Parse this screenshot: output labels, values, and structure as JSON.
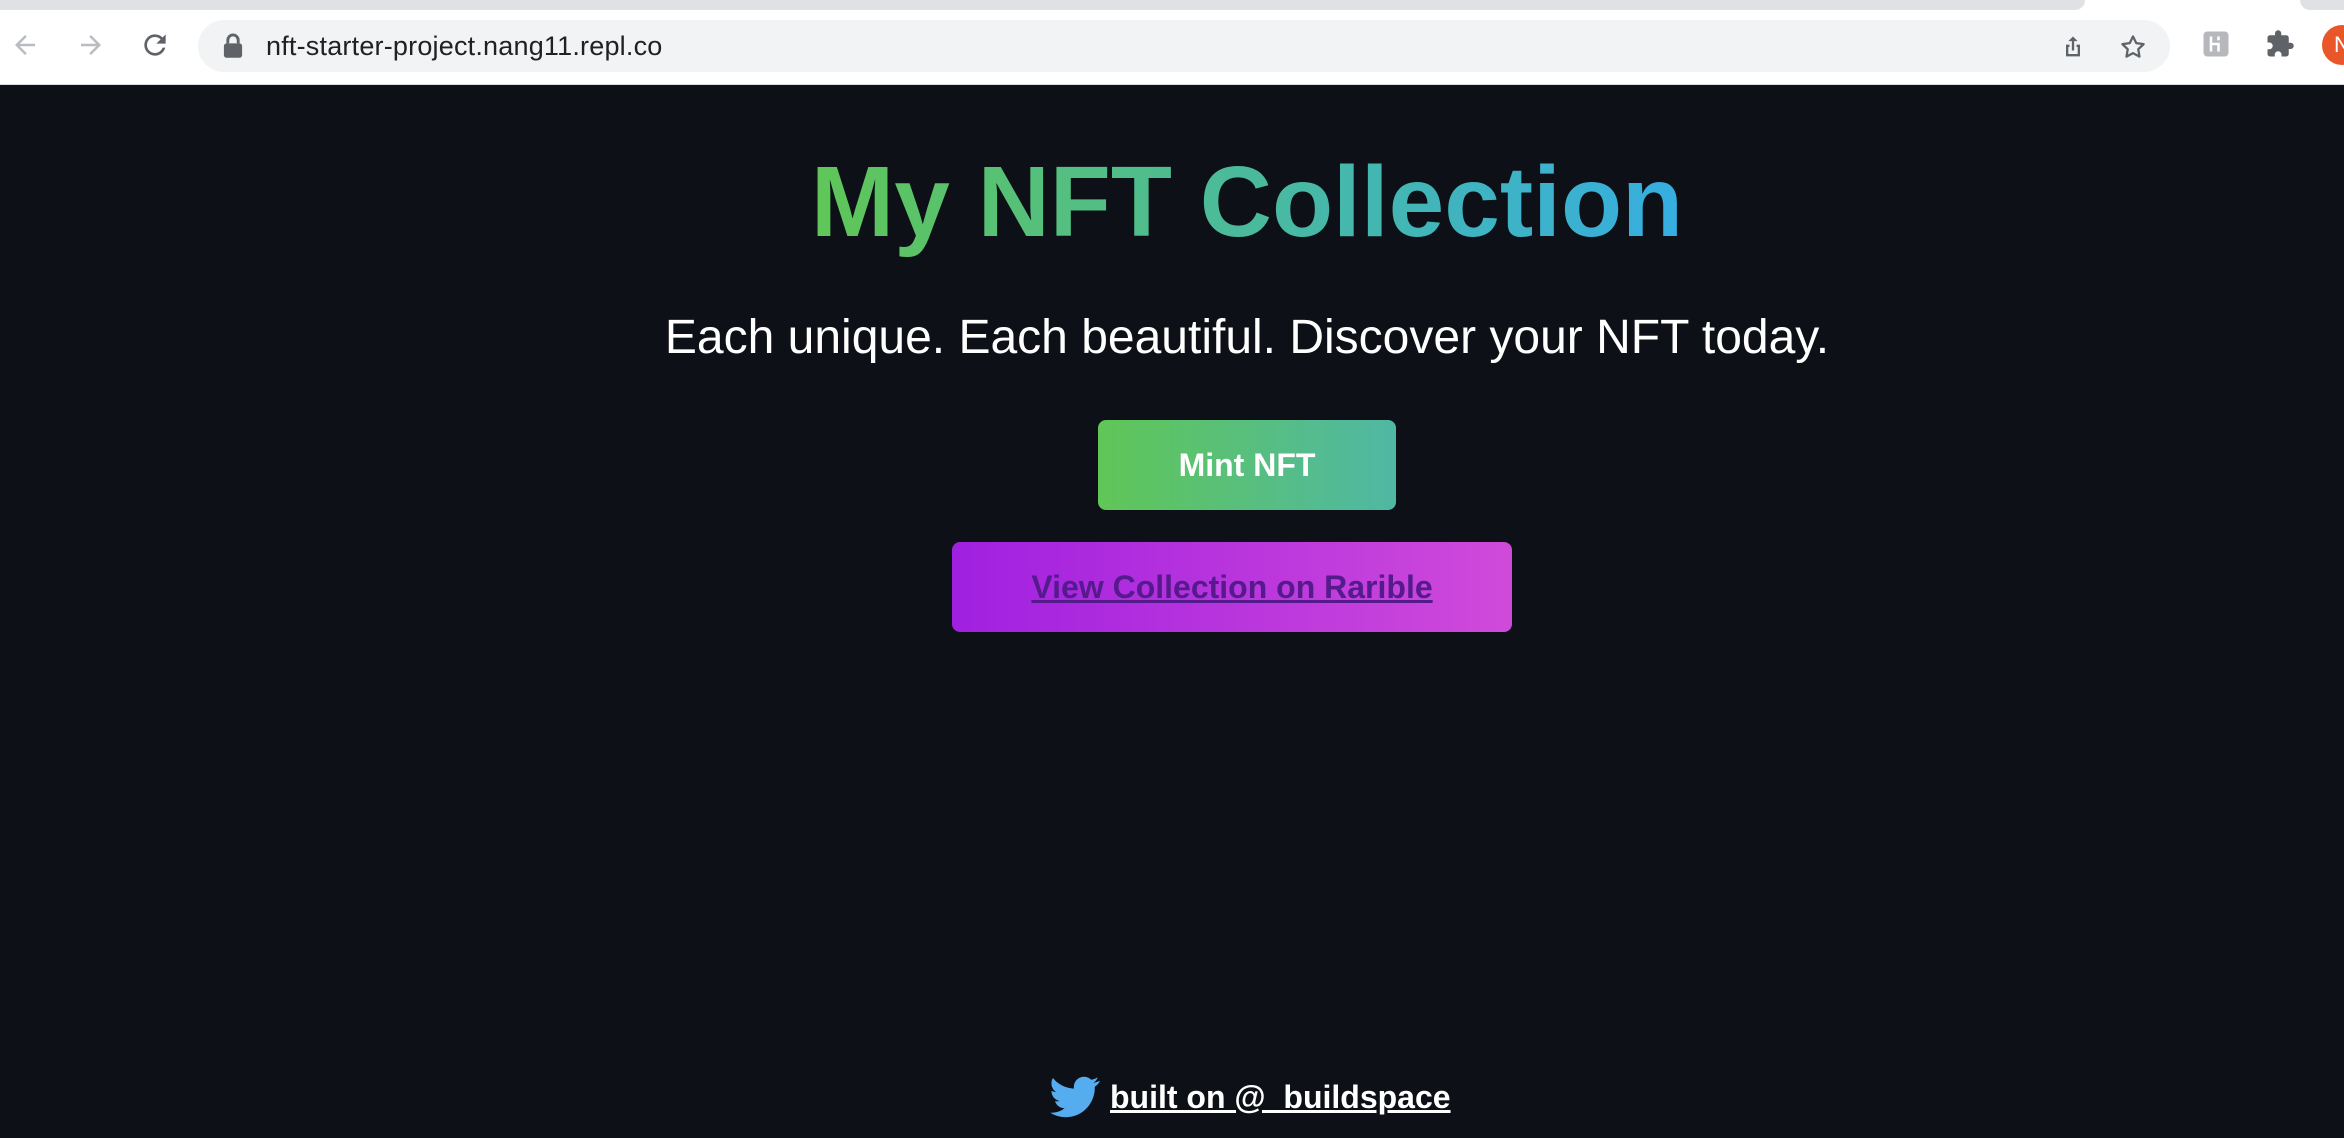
{
  "browser": {
    "url": "nft-starter-project.nang11.repl.co",
    "profile_initial": "N"
  },
  "page": {
    "title": "My NFT Collection",
    "subtitle": "Each unique. Each beautiful. Discover your NFT today.",
    "mint_button_label": "Mint NFT",
    "collection_link_label": "View Collection on Rarible",
    "footer_link_label": "built on @_buildspace"
  },
  "colors": {
    "background": "#0d1016",
    "gradient_green": "#60c657",
    "gradient_blue": "#35aee2",
    "purple_start": "#a020e0",
    "purple_end": "#d04ada",
    "twitter_blue": "#1da1f2"
  },
  "icons": [
    "back-arrow-icon",
    "forward-arrow-icon",
    "reload-icon",
    "lock-icon",
    "share-icon",
    "star-icon",
    "extension-h-icon",
    "puzzle-icon",
    "twitter-icon"
  ]
}
